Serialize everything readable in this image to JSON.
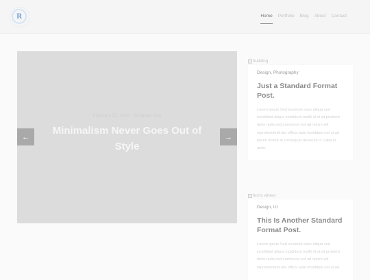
{
  "header": {
    "logo_letter": "R",
    "nav": [
      {
        "label": "Home",
        "active": true
      },
      {
        "label": "Portfolio",
        "active": false
      },
      {
        "label": "Blog",
        "active": false
      },
      {
        "label": "About",
        "active": false
      },
      {
        "label": "Contact",
        "active": false
      }
    ]
  },
  "slider": {
    "meta": "February 22, 2018 · Jonathan Doe",
    "title": "Minimalism Never Goes Out of Style",
    "prev_icon": "arrow-left-icon",
    "next_icon": "arrow-right-icon"
  },
  "posts": [
    {
      "image_alt": "building",
      "categories": "Design, Photography",
      "title": "Just a Standard Format Post.",
      "excerpt": "Lorem ipsum Sed eiusmod esse aliqua sed incididunt aliqua incididunt mollit id et sit proident dolor nulla sed commodo est ad minim elit reprehenderit nisi officia aute incididunt est ut ad ipsum dolore in consequat deserunt in culpa in anim."
    },
    {
      "image_alt": "ferris wheel",
      "categories": "Design, UI",
      "title": "This Is Another Standard Format Post.",
      "excerpt": "Lorem ipsum Sed eiusmod esse aliqua sed incididunt aliqua incididunt mollit id et sit proident dolor nulla sed commodo est ad minim elit reprehenderit nisi officia aute incididunt est ut ad."
    }
  ]
}
